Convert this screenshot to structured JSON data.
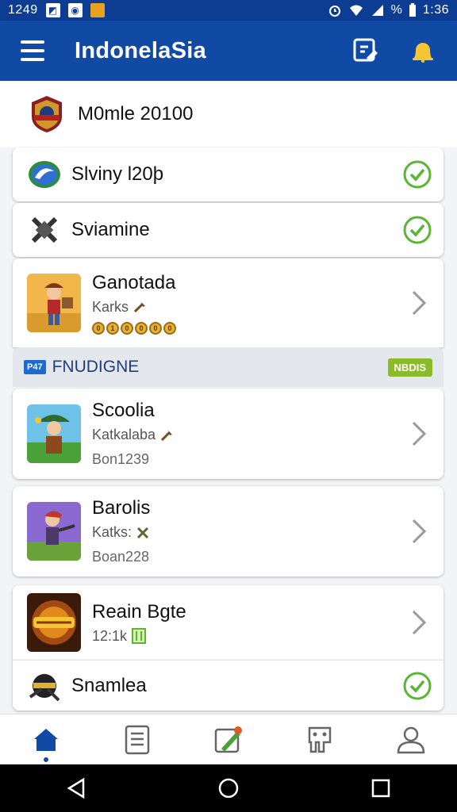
{
  "status_bar": {
    "time_left": "1249",
    "time_right": "1:36",
    "battery": "%"
  },
  "app_bar": {
    "title": "IndonelaSia"
  },
  "header": {
    "title": "M0mle 20100"
  },
  "rows": {
    "shiny": {
      "title": "Slviny l20þ"
    },
    "svi": {
      "title": "Sviamine"
    },
    "gano": {
      "title": "Ganotada",
      "sub": "Karks",
      "coins": [
        "0",
        "1",
        "0",
        "0",
        "0",
        "0"
      ]
    },
    "section": {
      "tag": "P47",
      "title": "FNUDIGNE",
      "badge": "NBDIS"
    },
    "scoolia": {
      "title": "Scoolia",
      "sub": "Katkalaba",
      "meta": "Bon1239"
    },
    "barolis": {
      "title": "Barolis",
      "sub": "Katks:",
      "meta": "Boan228"
    },
    "reain": {
      "title": "Reain Bgte",
      "sub": "12:1k"
    },
    "snamlea": {
      "title": "Snamlea"
    }
  },
  "colors": {
    "primary": "#114aa5",
    "check": "#5bb534",
    "section_badge": "#8bbb2a"
  },
  "icons": {
    "menu": "hamburger-icon",
    "edit": "edit-icon",
    "notifications": "bell-icon",
    "check": "checkmark-icon",
    "chevron": "chevron-right-icon",
    "nav": [
      "home-icon",
      "list-icon",
      "edit-pencil-icon",
      "puzzle-icon",
      "profile-icon"
    ],
    "system": [
      "back-icon",
      "home-circle-icon",
      "recents-icon"
    ]
  }
}
